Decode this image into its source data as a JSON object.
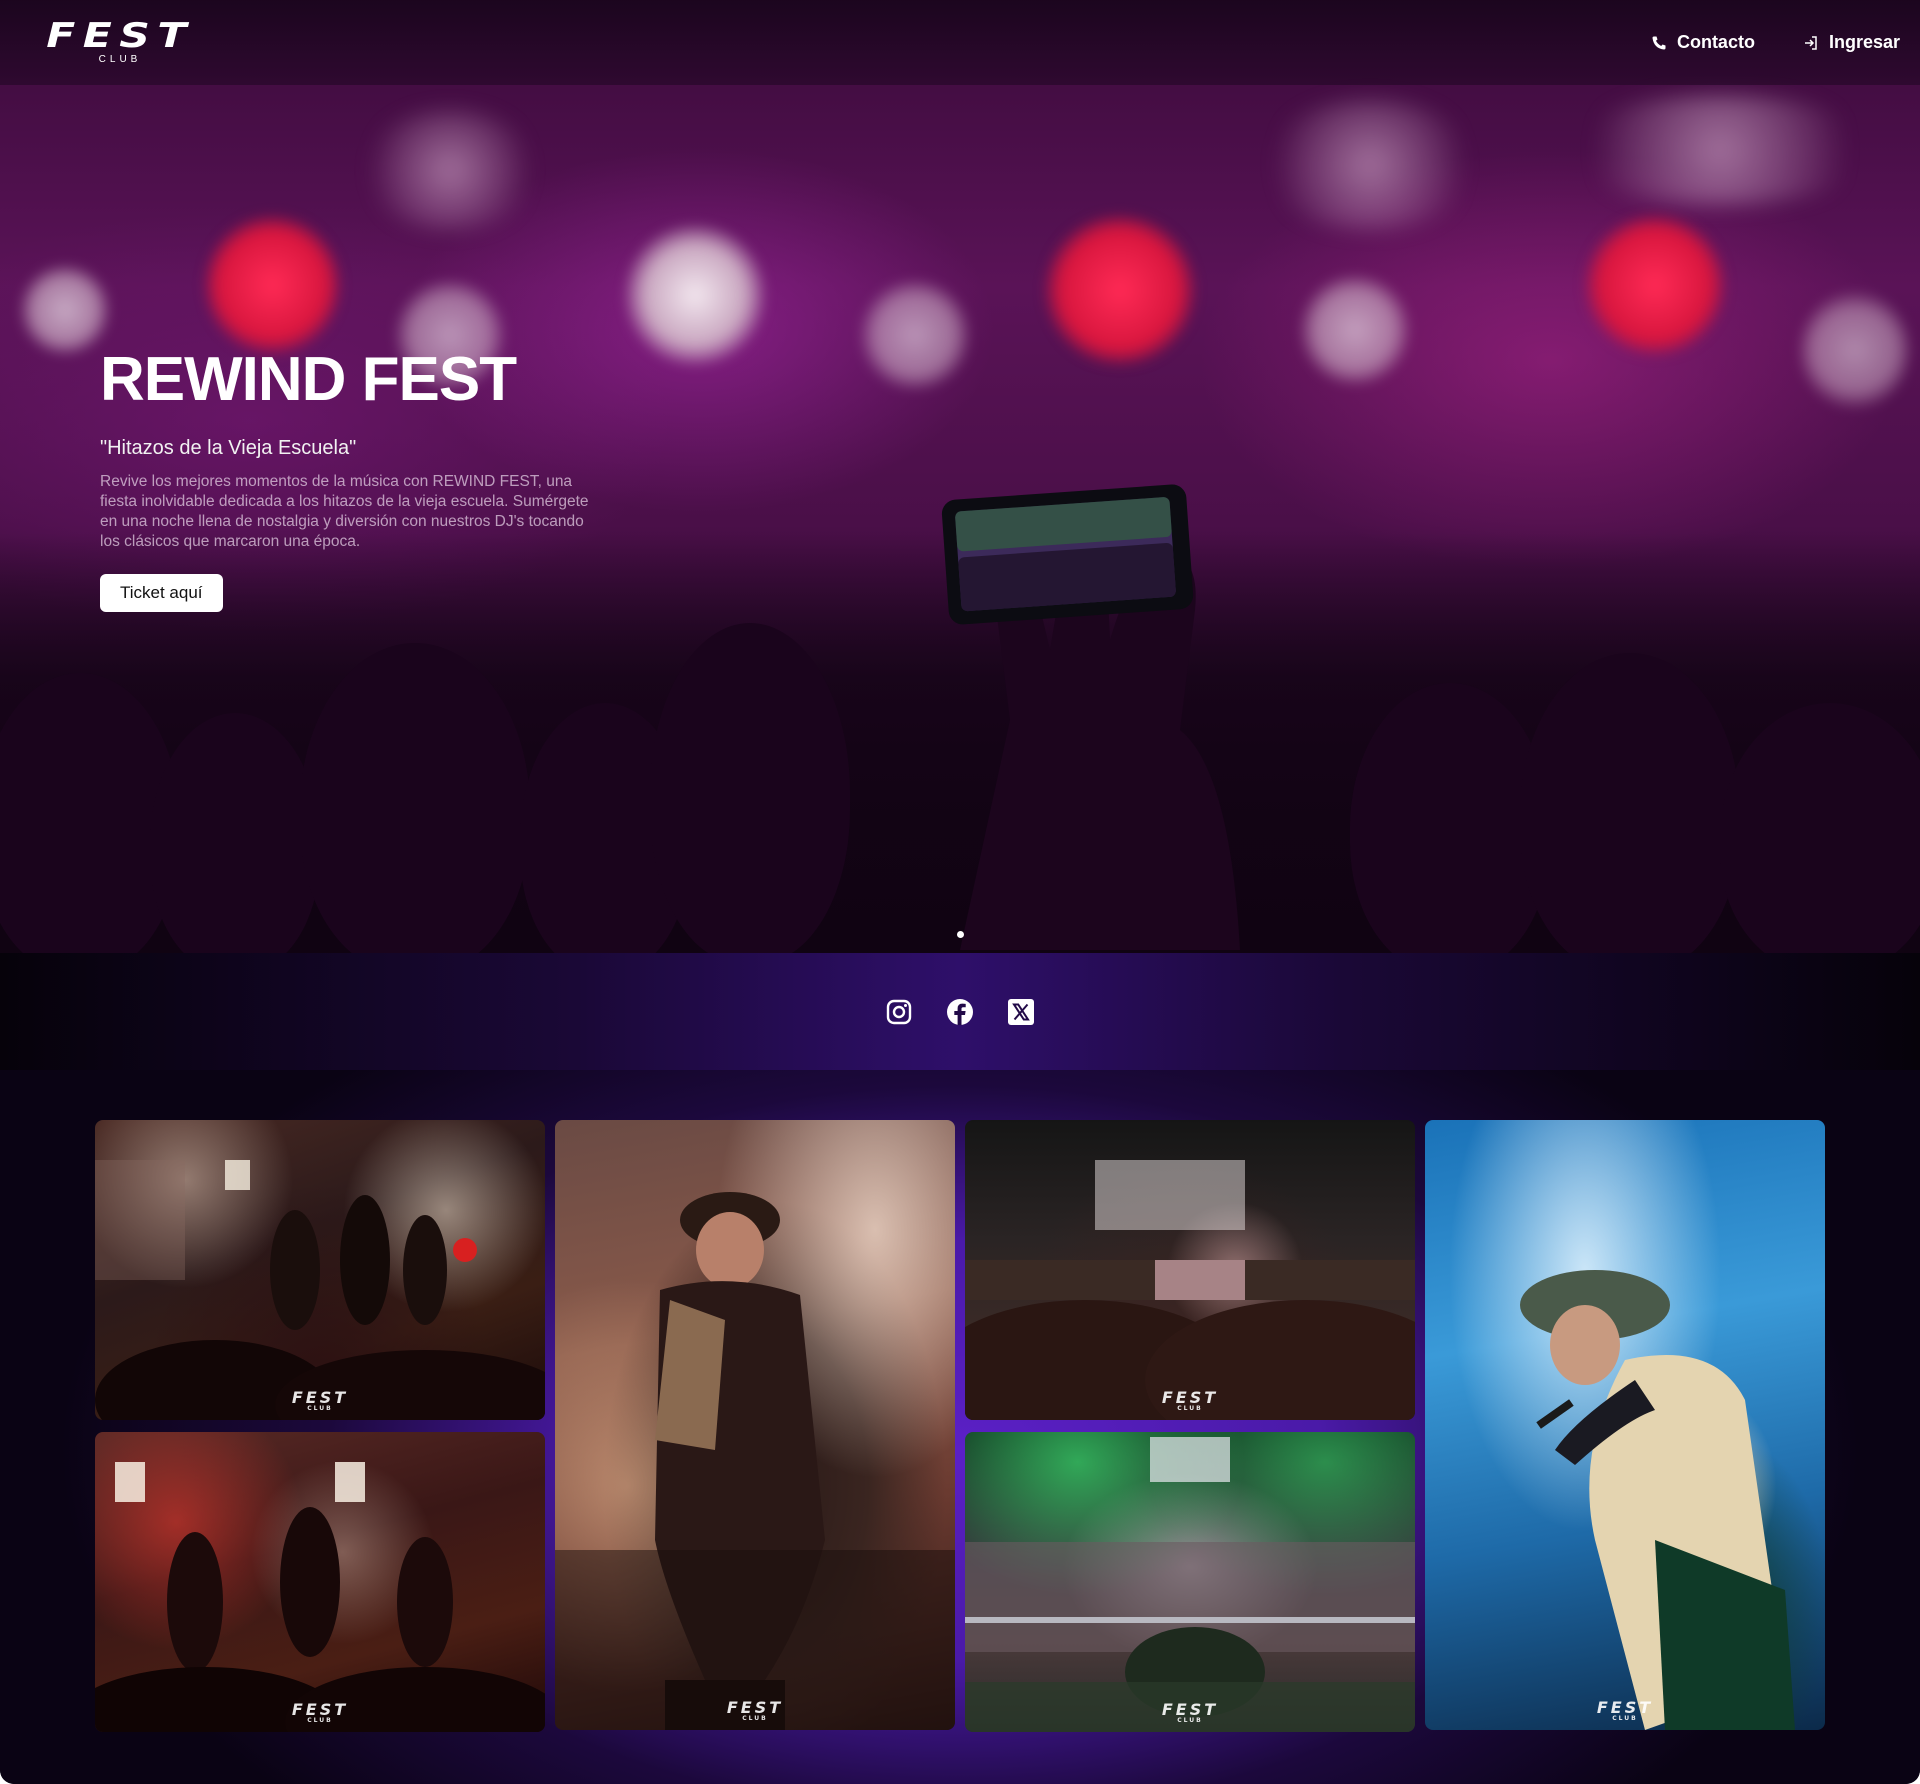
{
  "nav": {
    "logo_main": "FEST",
    "logo_sub": "CLUB",
    "contact_label": "Contacto",
    "login_label": "Ingresar"
  },
  "hero": {
    "title": "REWIND FEST",
    "subtitle": "\"Hitazos de la Vieja Escuela\"",
    "description": "Revive los mejores momentos de la música con REWIND FEST, una fiesta inolvidable dedicada a los hitazos de la vieja escuela. Sumérgete en una noche llena de nostalgia y diversión con nuestros DJ's tocando los clásicos que marcaron una época.",
    "cta_label": "Ticket aquí"
  },
  "social": {
    "icons": [
      "instagram-icon",
      "facebook-icon",
      "x-icon"
    ]
  },
  "gallery": {
    "watermark_main": "FEST",
    "watermark_sub": "CLUB"
  },
  "colors": {
    "accent_purple": "#5b20c6",
    "hero_magenta": "#5a1357",
    "button_bg": "#ffffff"
  }
}
